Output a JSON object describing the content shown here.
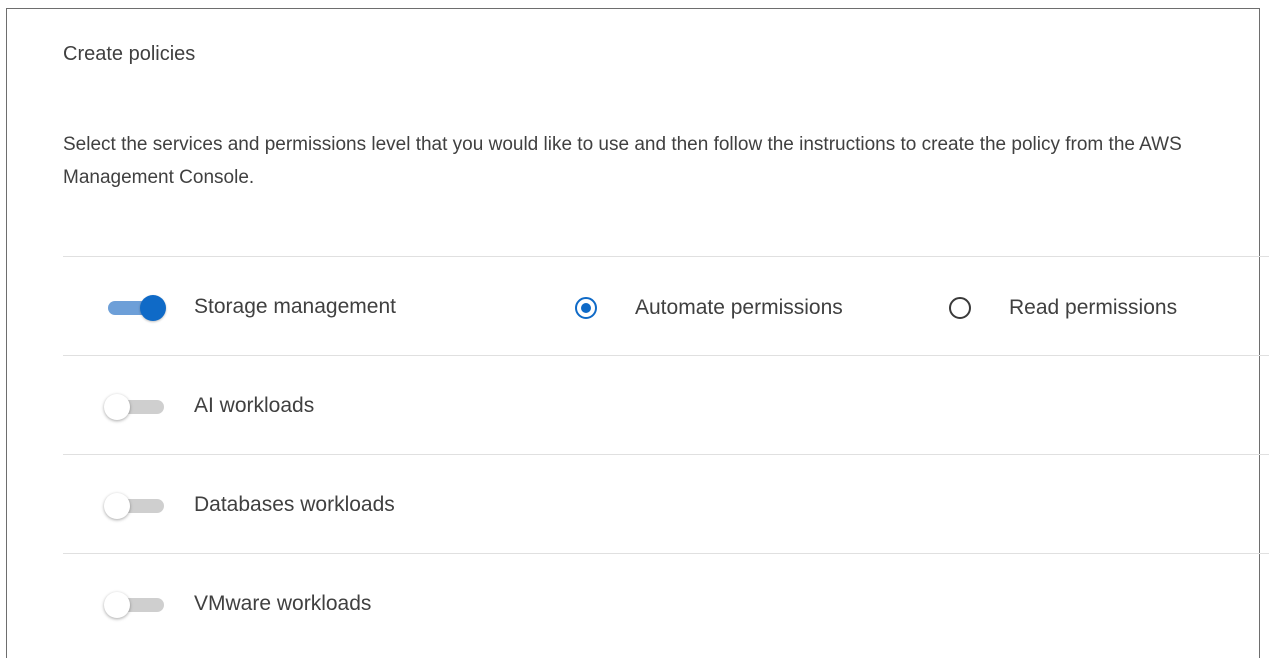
{
  "panel": {
    "title": "Create policies",
    "description": "Select the services and permissions level that you would like to use and then follow the instructions to create the policy from the AWS Management Console."
  },
  "services": [
    {
      "label": "Storage management",
      "enabled": true,
      "permissions": {
        "automate_label": "Automate permissions",
        "read_label": "Read permissions",
        "selected": "automate"
      }
    },
    {
      "label": "AI workloads",
      "enabled": false
    },
    {
      "label": "Databases workloads",
      "enabled": false
    },
    {
      "label": "VMware workloads",
      "enabled": false
    }
  ],
  "colors": {
    "accent": "#0f6ac7",
    "toggle_on_track": "#6d9fd8",
    "toggle_off_track": "#cfcfcf",
    "text": "#404040",
    "divider": "#e0e0e0"
  }
}
